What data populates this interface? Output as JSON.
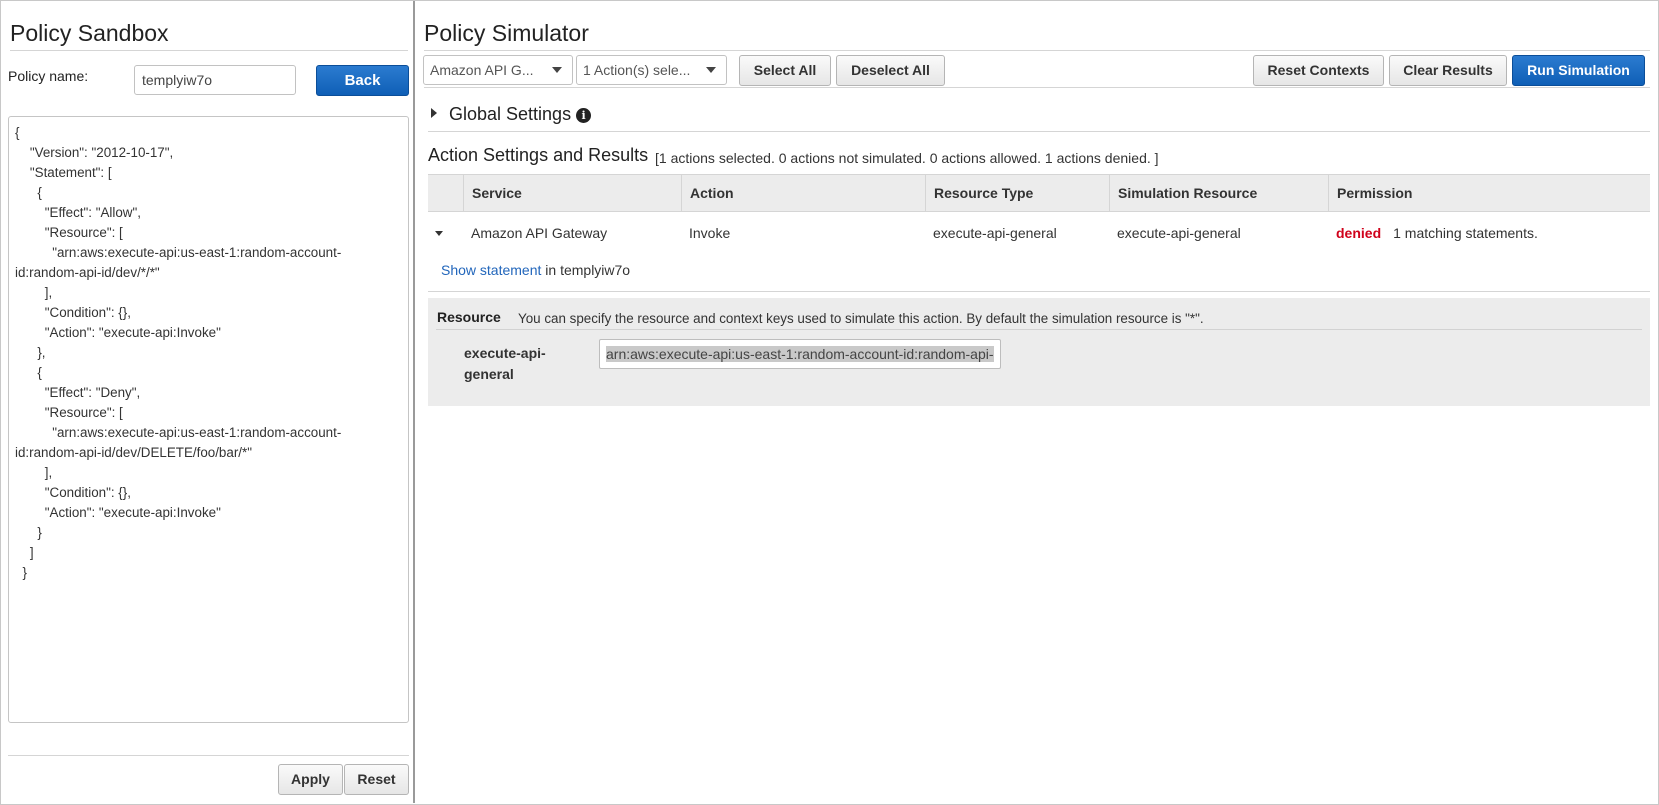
{
  "left_panel": {
    "title": "Policy Sandbox",
    "policy_name_label": "Policy name:",
    "policy_name_value": "templyiw7o",
    "back_button": "Back",
    "policy_document": "{\n    \"Version\": \"2012-10-17\",\n    \"Statement\": [\n      {\n        \"Effect\": \"Allow\",\n        \"Resource\": [\n          \"arn:aws:execute-api:us-east-1:random-account-id:random-api-id/dev/*/*\"\n        ],\n        \"Condition\": {},\n        \"Action\": \"execute-api:Invoke\"\n      },\n      {\n        \"Effect\": \"Deny\",\n        \"Resource\": [\n          \"arn:aws:execute-api:us-east-1:random-account-id:random-api-id/dev/DELETE/foo/bar/*\"\n        ],\n        \"Condition\": {},\n        \"Action\": \"execute-api:Invoke\"\n      }\n    ]\n  }",
    "apply_button": "Apply",
    "reset_button": "Reset"
  },
  "right_panel": {
    "title": "Policy Simulator",
    "service_select": "Amazon API G...",
    "actions_select": "1 Action(s) sele...",
    "select_all_button": "Select All",
    "deselect_all_button": "Deselect All",
    "reset_contexts_button": "Reset Contexts",
    "clear_results_button": "Clear Results",
    "run_simulation_button": "Run Simulation",
    "global_settings": "Global Settings",
    "action_settings_title": "Action Settings and Results",
    "action_summary": "[1 actions selected. 0 actions not simulated. 0 actions allowed. 1 actions denied. ]",
    "table": {
      "columns": [
        "Service",
        "Action",
        "Resource Type",
        "Simulation Resource",
        "Permission"
      ],
      "rows": [
        {
          "service": "Amazon API Gateway",
          "action": "Invoke",
          "resource_type": "execute-api-general",
          "simulation_resource": "execute-api-general",
          "permission": "denied",
          "permission_detail": "1 matching statements."
        }
      ]
    },
    "show_statement_link": "Show statement",
    "show_statement_suffix": "in templyiw7o",
    "resource_section": {
      "label": "Resource",
      "description": "You can specify the resource and context keys used to simulate this action. By default the simulation resource is \"*\".",
      "key_label": "execute-api-general",
      "value": "arn:aws:execute-api:us-east-1:random-account-id:random-api-"
    }
  },
  "colors": {
    "primary_button": "#1a6ec4",
    "denied": "#d0021b",
    "link": "#2266bb",
    "table_header_bg": "#ececec"
  }
}
